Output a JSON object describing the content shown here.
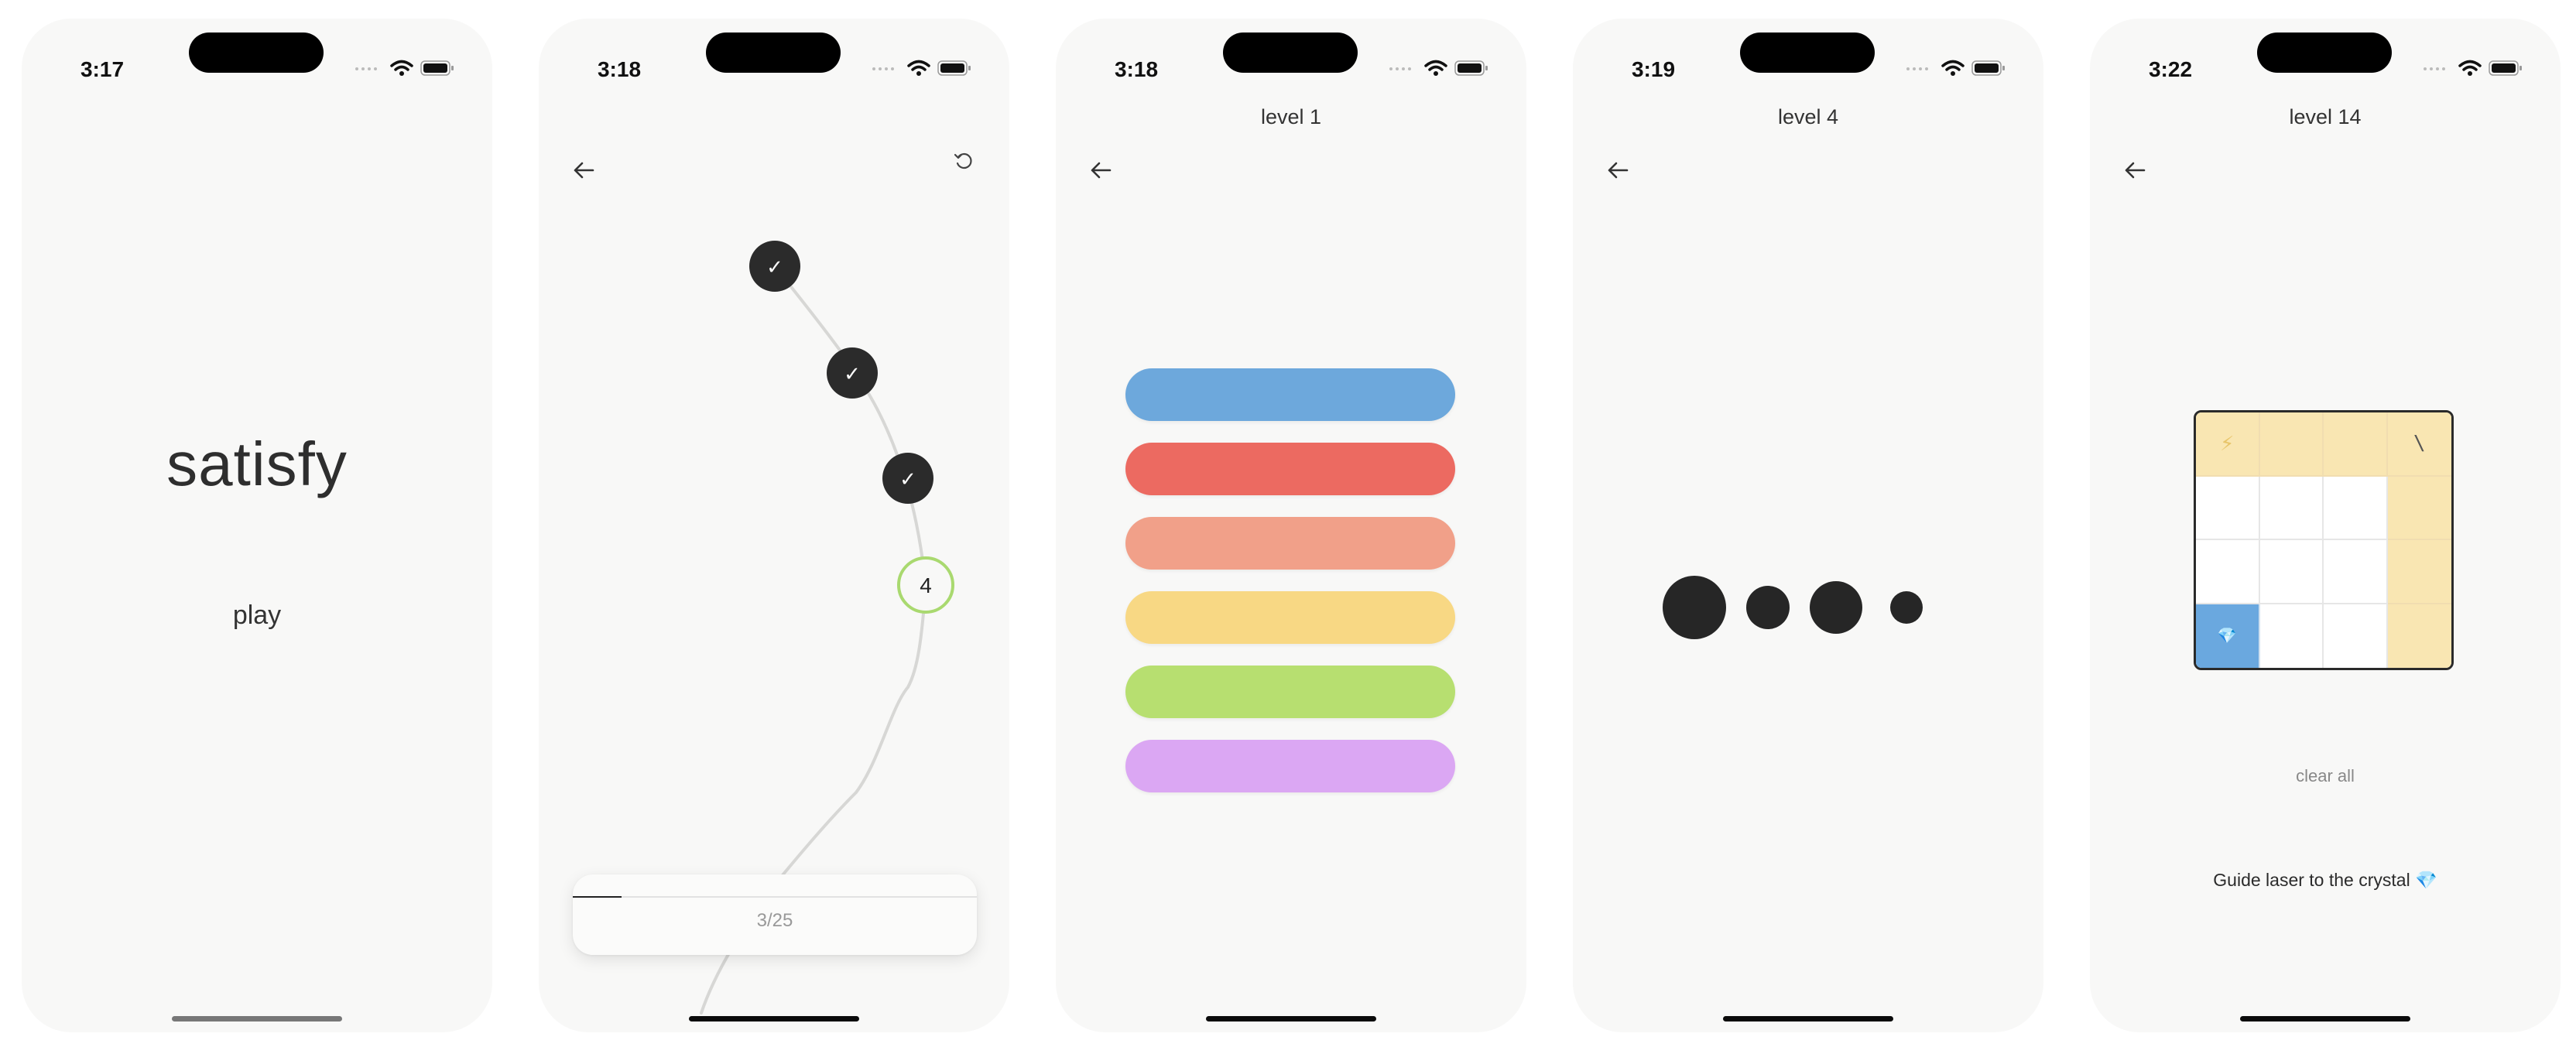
{
  "colors": {
    "background": "#f8f8f7",
    "ink": "#262626",
    "accent_green": "#a9d96f",
    "blue": "#6da8dc",
    "red": "#ec6a61",
    "salmon": "#f1a089",
    "yellow": "#f8d884",
    "green": "#b7df70",
    "purple": "#dba7f3",
    "path_yellow": "#f9e6b2"
  },
  "screens": [
    {
      "time": "3:17",
      "title": "satisfy",
      "play_label": "play"
    },
    {
      "time": "3:18",
      "levels": [
        {
          "label": "✓",
          "state": "completed"
        },
        {
          "label": "✓",
          "state": "completed"
        },
        {
          "label": "✓",
          "state": "completed"
        },
        {
          "label": "4",
          "state": "current"
        }
      ],
      "progress_text": "3/25",
      "progress_fraction": 0.12
    },
    {
      "time": "3:18",
      "level_title": "level 1",
      "bars": [
        "blue",
        "red",
        "salmon",
        "yellow",
        "green",
        "purple"
      ]
    },
    {
      "time": "3:19",
      "level_title": "level 4",
      "dot_count": 4
    },
    {
      "time": "3:22",
      "level_title": "level 14",
      "clear_label": "clear all",
      "hint": "Guide laser to the crystal 💎",
      "laser_glyph": "⚡",
      "mirror_glyph": "\\",
      "crystal_glyph": "💎"
    }
  ],
  "icons": {
    "status": [
      "cellular-signal-icon",
      "wifi-icon",
      "battery-icon"
    ],
    "navigation": [
      "back-arrow-icon",
      "reset-icon"
    ]
  }
}
